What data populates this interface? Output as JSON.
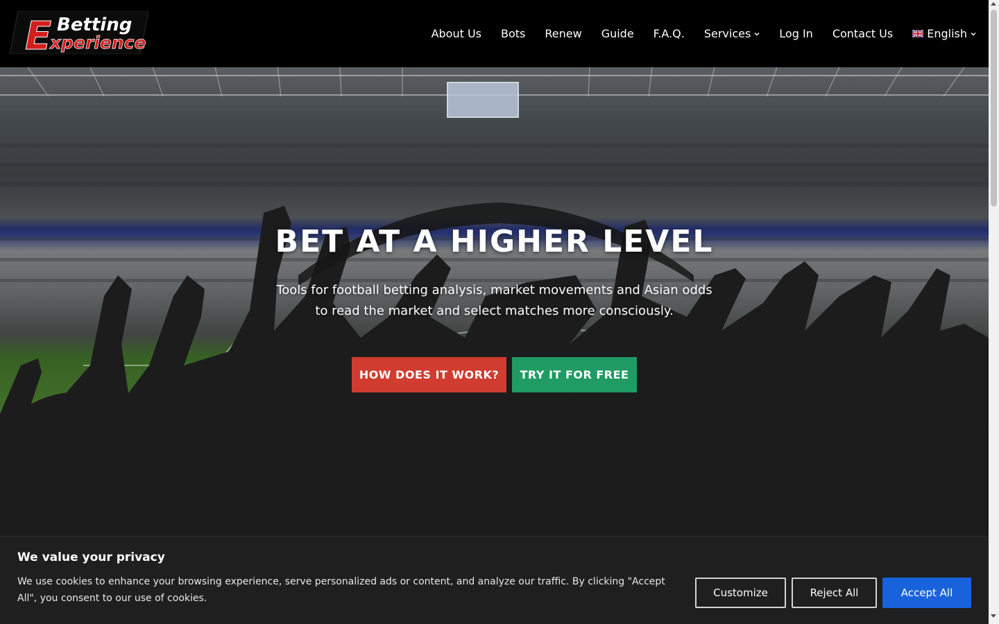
{
  "logo": {
    "line1": "Betting",
    "initial": "E",
    "line2": "xperience"
  },
  "nav": {
    "items": [
      {
        "label": "About Us"
      },
      {
        "label": "Bots"
      },
      {
        "label": "Renew"
      },
      {
        "label": "Guide"
      },
      {
        "label": "F.A.Q."
      },
      {
        "label": "Services"
      },
      {
        "label": "Log In"
      },
      {
        "label": "Contact Us"
      }
    ],
    "language": "English"
  },
  "hero": {
    "title": "BET AT A HIGHER LEVEL",
    "subtitle_line1": "Tools for football betting analysis, market movements and Asian odds",
    "subtitle_line2": "to read the market and select matches more consciously.",
    "primary_button": "HOW DOES IT WORK?",
    "secondary_button": "TRY IT FOR FREE"
  },
  "cookie_banner": {
    "title": "We value your privacy",
    "text": "We use cookies to enhance your browsing experience, serve personalized ads or content, and analyze our traffic. By clicking \"Accept All\", you consent to our use of cookies.",
    "customize": "Customize",
    "reject": "Reject All",
    "accept": "Accept All"
  },
  "colors": {
    "header_bg": "#000000",
    "logo_red": "#d41e1e",
    "primary_button": "#d03c2f",
    "secondary_button": "#1f9b63",
    "accept_button": "#1863dc",
    "banner_bg": "#1f1f1f"
  }
}
